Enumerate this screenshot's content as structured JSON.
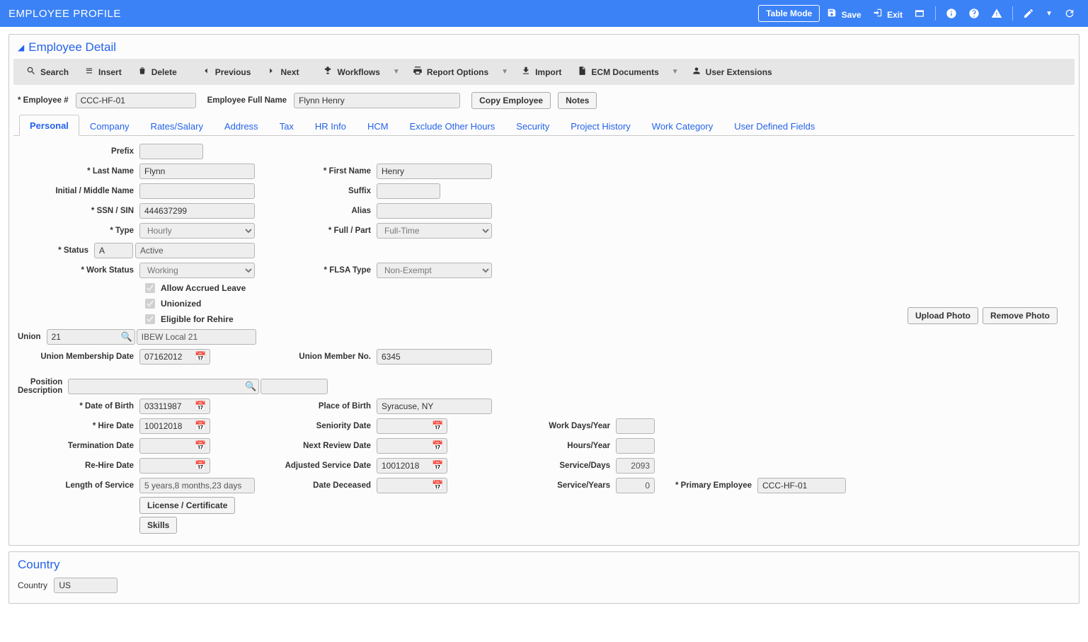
{
  "header": {
    "title": "EMPLOYEE PROFILE",
    "tableMode": "Table Mode",
    "save": "Save",
    "exit": "Exit"
  },
  "panel": {
    "title": "Employee Detail"
  },
  "toolbar": {
    "search": "Search",
    "insert": "Insert",
    "delete": "Delete",
    "previous": "Previous",
    "next": "Next",
    "workflows": "Workflows",
    "reportOptions": "Report Options",
    "import": "Import",
    "ecm": "ECM Documents",
    "userExt": "User Extensions"
  },
  "keyRow": {
    "empNumLabel": "Employee #",
    "empNum": "CCC-HF-01",
    "fullNameLabel": "Employee Full Name",
    "fullName": "Flynn Henry",
    "copyEmployee": "Copy Employee",
    "notes": "Notes"
  },
  "tabs": [
    "Personal",
    "Company",
    "Rates/Salary",
    "Address",
    "Tax",
    "HR Info",
    "HCM",
    "Exclude Other Hours",
    "Security",
    "Project History",
    "Work Category",
    "User Defined Fields"
  ],
  "labels": {
    "prefix": "Prefix",
    "lastName": "Last Name",
    "firstName": "First Name",
    "initialMiddle": "Initial / Middle Name",
    "suffix": "Suffix",
    "ssn": "SSN / SIN",
    "alias": "Alias",
    "type": "Type",
    "fullPart": "Full / Part",
    "status": "Status",
    "workStatus": "Work Status",
    "flsa": "FLSA Type",
    "allowAccrued": "Allow Accrued Leave",
    "unionized": "Unionized",
    "eligibleRehire": "Eligible for Rehire",
    "union": "Union",
    "unionDate": "Union Membership Date",
    "unionMemberNo": "Union Member No.",
    "positionDesc": "Position Description",
    "dob": "Date of Birth",
    "placeBirth": "Place of Birth",
    "hireDate": "Hire Date",
    "seniorityDate": "Seniority Date",
    "workDaysYear": "Work Days/Year",
    "terminationDate": "Termination Date",
    "nextReview": "Next Review Date",
    "hoursYear": "Hours/Year",
    "reHireDate": "Re-Hire Date",
    "adjService": "Adjusted Service Date",
    "serviceDays": "Service/Days",
    "lengthService": "Length of Service",
    "dateDeceased": "Date Deceased",
    "serviceYears": "Service/Years",
    "primaryEmployee": "Primary Employee",
    "licenseCert": "License / Certificate",
    "skills": "Skills",
    "uploadPhoto": "Upload Photo",
    "removePhoto": "Remove Photo"
  },
  "values": {
    "prefix": "",
    "lastName": "Flynn",
    "firstName": "Henry",
    "initialMiddle": "",
    "suffix": "",
    "ssn": "444637299",
    "alias": "",
    "type": "Hourly",
    "fullPart": "Full-Time",
    "statusCode": "A",
    "statusDesc": "Active",
    "workStatus": "Working",
    "flsa": "Non-Exempt",
    "unionCode": "21",
    "unionDesc": "IBEW Local 21",
    "unionDate": "07162012",
    "unionMemberNo": "6345",
    "positionDesc": "",
    "positionDesc2": "",
    "dob": "03311987",
    "placeBirth": "Syracuse, NY",
    "hireDate": "10012018",
    "seniorityDate": "",
    "workDaysYear": "",
    "terminationDate": "",
    "nextReview": "",
    "hoursYear": "",
    "reHireDate": "",
    "adjService": "10012018",
    "serviceDays": "2093",
    "lengthService": "5 years,8 months,23 days",
    "dateDeceased": "",
    "serviceYears": "0",
    "primaryEmployee": "CCC-HF-01"
  },
  "countryPanel": {
    "title": "Country",
    "label": "Country",
    "value": "US"
  }
}
